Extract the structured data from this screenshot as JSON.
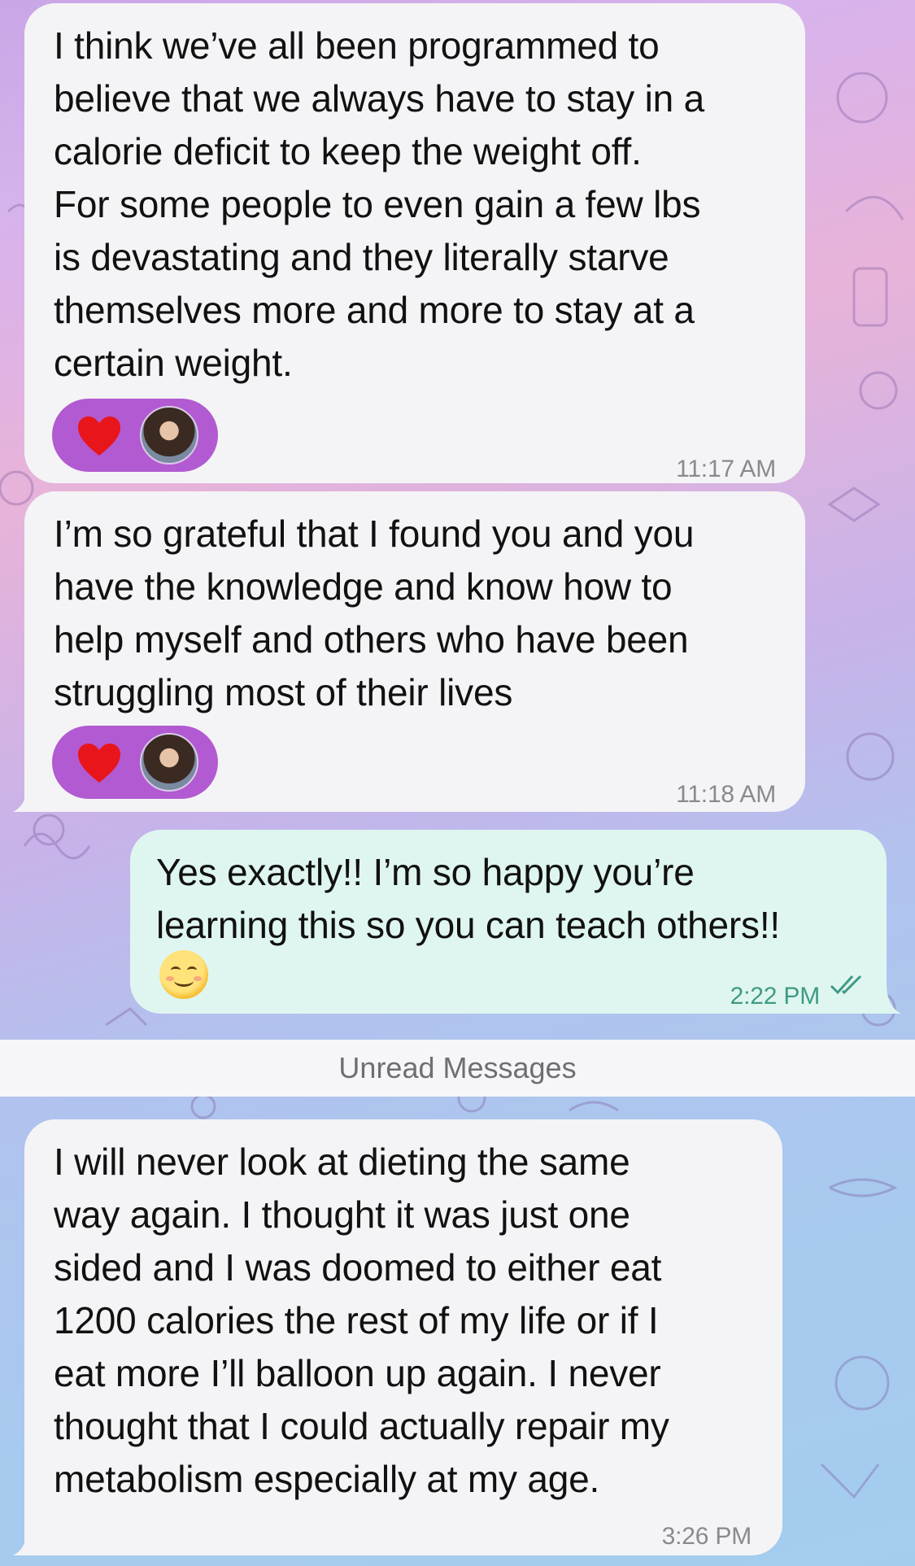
{
  "messages": [
    {
      "direction": "incoming",
      "text": "I think we’ve all been programmed to\nbelieve that we always have to stay in a\ncalorie deficit to keep the weight off.\nFor some people to even gain a few lbs\nis devastating and they literally starve\nthemselves more and more to stay at a\ncertain weight.",
      "time": "11:17 AM",
      "reaction": "heart-icon"
    },
    {
      "direction": "incoming",
      "text": "I’m so grateful that I found you and you\nhave the knowledge and know how to\nhelp myself and others who have been\nstruggling most of their lives",
      "time": "11:18 AM",
      "reaction": "heart-icon"
    },
    {
      "direction": "outgoing",
      "text": "Yes exactly!! I’m so happy you’re\nlearning this so you can teach others!!",
      "emoji": "smiling-face-icon",
      "time": "2:22 PM",
      "status": "read"
    },
    {
      "direction": "incoming",
      "text": "I will never look at dieting the same\nway again.  I thought it was just one\nsided and I was doomed to either eat\n1200 calories the rest of my life or if I\neat more I’ll balloon up again.  I never\nthought that I could actually repair my\nmetabolism especially at my age.",
      "time": "3:26 PM"
    }
  ],
  "unread_label": "Unread Messages",
  "colors": {
    "incoming_bubble": "#f4f4f6",
    "outgoing_bubble": "#dff6f0",
    "reaction_pill": "#b25ad1",
    "heart": "#e8151b",
    "outgoing_time": "#3f9a85"
  }
}
